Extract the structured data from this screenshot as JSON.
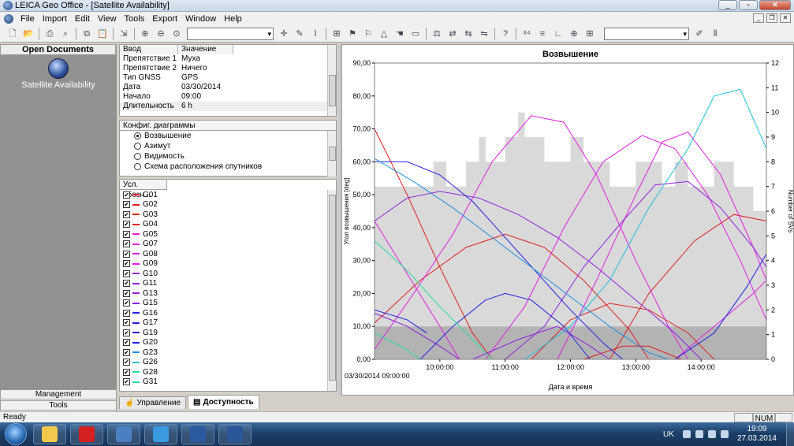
{
  "window": {
    "title": "LEICA Geo Office - [Satellite Availability]"
  },
  "menu": [
    "File",
    "Import",
    "Edit",
    "View",
    "Tools",
    "Export",
    "Window",
    "Help"
  ],
  "left_panel": {
    "header": "Open Documents",
    "document": "Satellite Availability",
    "bottom_buttons": [
      "Management",
      "Tools"
    ]
  },
  "properties": {
    "col_input": "Ввод",
    "col_value": "Значение",
    "rows": [
      {
        "k": "Препятствие 1",
        "v": "Муха"
      },
      {
        "k": "Препятствие 2",
        "v": "Ничего"
      },
      {
        "k": "Тип GNSS",
        "v": "GPS"
      },
      {
        "k": "Дата",
        "v": "03/30/2014"
      },
      {
        "k": "Начало",
        "v": "09:00"
      },
      {
        "k": "Длительность",
        "v": "6 h"
      }
    ]
  },
  "config": {
    "header": "Конфиг. диаграммы",
    "options": [
      "Возвышение",
      "Азимут",
      "Видимость",
      "Схема расположения спутников"
    ],
    "selected": 0
  },
  "legend": {
    "header": "Усл. обозн...",
    "items": [
      {
        "name": "G01",
        "color": "#e02020"
      },
      {
        "name": "G02",
        "color": "#e02020"
      },
      {
        "name": "G03",
        "color": "#e02020"
      },
      {
        "name": "G04",
        "color": "#e02020"
      },
      {
        "name": "G05",
        "color": "#e020e0"
      },
      {
        "name": "G07",
        "color": "#e020e0"
      },
      {
        "name": "G08",
        "color": "#e020e0"
      },
      {
        "name": "G09",
        "color": "#e020e0"
      },
      {
        "name": "G10",
        "color": "#9020e0"
      },
      {
        "name": "G11",
        "color": "#9020e0"
      },
      {
        "name": "G13",
        "color": "#9020e0"
      },
      {
        "name": "G15",
        "color": "#9020e0"
      },
      {
        "name": "G16",
        "color": "#2020e0"
      },
      {
        "name": "G17",
        "color": "#2020e0"
      },
      {
        "name": "G19",
        "color": "#2020e0"
      },
      {
        "name": "G20",
        "color": "#2020e0"
      },
      {
        "name": "G23",
        "color": "#2090e0"
      },
      {
        "name": "G26",
        "color": "#20c0e0"
      },
      {
        "name": "G28",
        "color": "#20e0a0"
      },
      {
        "name": "G31",
        "color": "#20e0a0"
      }
    ]
  },
  "tabs": [
    {
      "label": "Управление",
      "active": false
    },
    {
      "label": "Доступность",
      "active": true
    }
  ],
  "status": {
    "left": "Ready",
    "num": "NUM"
  },
  "taskbar": {
    "lang": "UK",
    "time": "19:09",
    "date": "27.03.2014",
    "apps": [
      {
        "name": "explorer",
        "color": "#f2c94c"
      },
      {
        "name": "opera",
        "color": "#d42020"
      },
      {
        "name": "app-globe",
        "color": "#4a7fc1"
      },
      {
        "name": "ie",
        "color": "#3a9ae0"
      },
      {
        "name": "leica",
        "color": "#2a5aa0"
      },
      {
        "name": "word",
        "color": "#2b579a"
      }
    ]
  },
  "chart_data": {
    "type": "line",
    "title": "Возвышение",
    "xlabel": "Дата и время",
    "ylabel": "Угол возвышения [deg]",
    "y2label": "Number of SVs",
    "start_label": "03/30/2014 09:00:00",
    "x_ticks": [
      "10:00:00",
      "11:00:00",
      "12:00:00",
      "13:00:00",
      "14:00:00"
    ],
    "xlim": [
      9.0,
      15.0
    ],
    "ylim": [
      0,
      90
    ],
    "y_ticks": [
      "0,00",
      "10,00",
      "20,00",
      "30,00",
      "40,00",
      "50,00",
      "60,00",
      "70,00",
      "80,00",
      "90,00"
    ],
    "y2lim": [
      0,
      12
    ],
    "y2_ticks": [
      0,
      1,
      2,
      3,
      4,
      5,
      6,
      7,
      8,
      9,
      10,
      11,
      12
    ],
    "cutoff_elevation": 10,
    "sv_count": [
      [
        9.0,
        7
      ],
      [
        9.9,
        7
      ],
      [
        9.9,
        8
      ],
      [
        10.1,
        8
      ],
      [
        10.1,
        7
      ],
      [
        10.4,
        7
      ],
      [
        10.4,
        8
      ],
      [
        10.6,
        8
      ],
      [
        10.6,
        9
      ],
      [
        10.7,
        9
      ],
      [
        10.7,
        8
      ],
      [
        11.0,
        8
      ],
      [
        11.0,
        9
      ],
      [
        11.2,
        9
      ],
      [
        11.2,
        10
      ],
      [
        11.3,
        10
      ],
      [
        11.3,
        9
      ],
      [
        11.6,
        9
      ],
      [
        11.6,
        8
      ],
      [
        12.0,
        8
      ],
      [
        12.0,
        9
      ],
      [
        12.2,
        9
      ],
      [
        12.2,
        8
      ],
      [
        12.6,
        8
      ],
      [
        12.6,
        7
      ],
      [
        13.0,
        7
      ],
      [
        13.0,
        8
      ],
      [
        13.4,
        8
      ],
      [
        13.4,
        7
      ],
      [
        13.6,
        7
      ],
      [
        13.6,
        8
      ],
      [
        13.8,
        8
      ],
      [
        13.8,
        7
      ],
      [
        14.2,
        7
      ],
      [
        14.2,
        8
      ],
      [
        14.5,
        8
      ],
      [
        14.5,
        7
      ],
      [
        14.8,
        7
      ],
      [
        14.8,
        6
      ],
      [
        15.0,
        6
      ]
    ],
    "series": [
      {
        "color": "#e02020",
        "points": [
          [
            9.0,
            70
          ],
          [
            9.5,
            50
          ],
          [
            10.0,
            28
          ],
          [
            10.5,
            8
          ],
          [
            10.8,
            0
          ]
        ]
      },
      {
        "color": "#e02020",
        "points": [
          [
            9.0,
            11
          ],
          [
            9.7,
            24
          ],
          [
            10.4,
            34
          ],
          [
            11.0,
            38
          ],
          [
            11.6,
            34
          ],
          [
            12.2,
            24
          ],
          [
            12.9,
            9
          ],
          [
            13.2,
            0
          ]
        ]
      },
      {
        "color": "#e02020",
        "points": [
          [
            11.4,
            0
          ],
          [
            12.0,
            12
          ],
          [
            12.6,
            17
          ],
          [
            13.2,
            15
          ],
          [
            13.8,
            8
          ],
          [
            14.2,
            0
          ]
        ]
      },
      {
        "color": "#e02020",
        "points": [
          [
            12.2,
            0
          ],
          [
            12.8,
            4
          ],
          [
            13.2,
            4
          ],
          [
            13.7,
            0
          ]
        ]
      },
      {
        "color": "#e02020",
        "points": [
          [
            12.6,
            0
          ],
          [
            13.2,
            20
          ],
          [
            13.9,
            36
          ],
          [
            14.5,
            44
          ],
          [
            15.0,
            42
          ]
        ]
      },
      {
        "color": "#e020e0",
        "points": [
          [
            9.0,
            3
          ],
          [
            9.6,
            20
          ],
          [
            10.2,
            38
          ],
          [
            10.8,
            60
          ],
          [
            11.4,
            74
          ],
          [
            11.9,
            72
          ],
          [
            12.4,
            56
          ],
          [
            13.0,
            30
          ],
          [
            13.5,
            10
          ],
          [
            13.8,
            0
          ]
        ]
      },
      {
        "color": "#e020e0",
        "points": [
          [
            9.0,
            42
          ],
          [
            9.5,
            26
          ],
          [
            10.0,
            10
          ],
          [
            10.3,
            0
          ]
        ]
      },
      {
        "color": "#e020e0",
        "points": [
          [
            10.7,
            0
          ],
          [
            11.3,
            16
          ],
          [
            11.9,
            40
          ],
          [
            12.5,
            60
          ],
          [
            13.1,
            68
          ],
          [
            13.6,
            64
          ],
          [
            14.1,
            50
          ],
          [
            14.6,
            30
          ],
          [
            15.0,
            12
          ]
        ]
      },
      {
        "color": "#e020e0",
        "points": [
          [
            11.8,
            0
          ],
          [
            12.4,
            24
          ],
          [
            13.0,
            50
          ],
          [
            13.4,
            66
          ],
          [
            13.8,
            69
          ],
          [
            14.3,
            56
          ],
          [
            14.8,
            34
          ],
          [
            15.0,
            24
          ]
        ]
      },
      {
        "color": "#e020e0",
        "points": [
          [
            13.6,
            0
          ],
          [
            14.2,
            10
          ],
          [
            14.8,
            20
          ],
          [
            15.0,
            24
          ]
        ]
      },
      {
        "color": "#9020e0",
        "points": [
          [
            9.0,
            42
          ],
          [
            9.5,
            49
          ],
          [
            10.0,
            51
          ],
          [
            10.6,
            49
          ],
          [
            11.2,
            44
          ],
          [
            11.8,
            37
          ],
          [
            12.4,
            28
          ],
          [
            13.0,
            18
          ],
          [
            13.6,
            8
          ],
          [
            14.0,
            0
          ]
        ]
      },
      {
        "color": "#9020e0",
        "points": [
          [
            9.0,
            14
          ],
          [
            9.5,
            10
          ],
          [
            10.0,
            4
          ],
          [
            10.3,
            0
          ]
        ]
      },
      {
        "color": "#9020e0",
        "points": [
          [
            10.5,
            0
          ],
          [
            11.2,
            6
          ],
          [
            11.8,
            10
          ],
          [
            12.3,
            4
          ],
          [
            12.6,
            0
          ]
        ]
      },
      {
        "color": "#9020e0",
        "points": [
          [
            11.0,
            0
          ],
          [
            11.6,
            10
          ],
          [
            12.2,
            28
          ],
          [
            12.8,
            42
          ],
          [
            13.3,
            53
          ],
          [
            13.8,
            54
          ],
          [
            14.3,
            46
          ],
          [
            14.8,
            34
          ],
          [
            15.0,
            28
          ]
        ]
      },
      {
        "color": "#2020e0",
        "points": [
          [
            9.0,
            60
          ],
          [
            9.5,
            60
          ],
          [
            10.0,
            56
          ],
          [
            10.5,
            48
          ],
          [
            11.0,
            37
          ],
          [
            11.5,
            26
          ],
          [
            12.0,
            15
          ],
          [
            12.5,
            5
          ],
          [
            12.8,
            0
          ]
        ]
      },
      {
        "color": "#2020e0",
        "points": [
          [
            9.0,
            15
          ],
          [
            9.5,
            12
          ],
          [
            9.8,
            8
          ]
        ]
      },
      {
        "color": "#2020e0",
        "points": [
          [
            9.7,
            0
          ],
          [
            10.2,
            10
          ],
          [
            10.7,
            18
          ],
          [
            11.0,
            20
          ],
          [
            11.4,
            18
          ],
          [
            11.9,
            10
          ],
          [
            12.3,
            0
          ]
        ]
      },
      {
        "color": "#2020e0",
        "points": [
          [
            13.6,
            0
          ],
          [
            14.2,
            8
          ],
          [
            14.7,
            22
          ],
          [
            15.0,
            32
          ]
        ]
      },
      {
        "color": "#2090e0",
        "points": [
          [
            9.0,
            61
          ],
          [
            9.6,
            54
          ],
          [
            10.2,
            46
          ],
          [
            10.8,
            37
          ],
          [
            11.4,
            28
          ],
          [
            12.0,
            19
          ],
          [
            12.6,
            10
          ],
          [
            13.2,
            2
          ],
          [
            13.5,
            0
          ]
        ]
      },
      {
        "color": "#20c0e0",
        "points": [
          [
            11.3,
            0
          ],
          [
            12.0,
            10
          ],
          [
            12.6,
            24
          ],
          [
            13.2,
            46
          ],
          [
            13.8,
            64
          ],
          [
            14.2,
            80
          ],
          [
            14.6,
            82
          ],
          [
            15.0,
            64
          ]
        ]
      },
      {
        "color": "#20e0a0",
        "points": [
          [
            9.0,
            36
          ],
          [
            9.5,
            27
          ],
          [
            10.0,
            16
          ],
          [
            10.5,
            6
          ],
          [
            10.8,
            0
          ]
        ]
      },
      {
        "color": "#20e0a0",
        "points": [
          [
            9.0,
            8
          ],
          [
            9.4,
            4
          ],
          [
            9.7,
            0
          ]
        ]
      }
    ]
  }
}
